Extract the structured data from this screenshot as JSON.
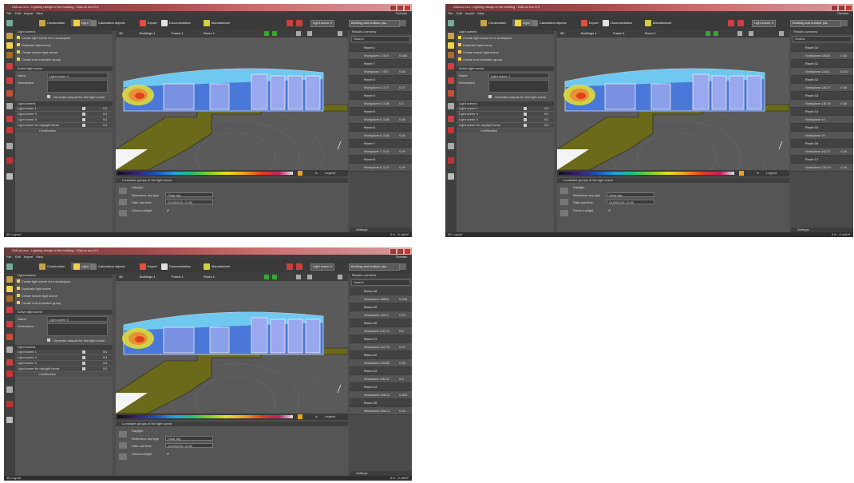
{
  "window": {
    "title": "DIALux evo - Lighting design of the building - DIALux evo 8.0"
  },
  "menu": {
    "items": [
      "File",
      "Edit",
      "Import",
      "View"
    ],
    "help": "Themes"
  },
  "toolbar": {
    "modes": [
      "Construction",
      "Light",
      "Calculation objects",
      "Export",
      "Documentation",
      "Manufacturer"
    ],
    "light_scene_select": "Light scene 4",
    "building_select": "Building and outdoor pla..."
  },
  "left_panel": {
    "light_scenes_header": "Light scenes",
    "actions": [
      "Create light scene for a workspace",
      "Duplicate light scene",
      "Create simple light scene",
      "Create new luminaire group"
    ],
    "active_header": "Active light scene",
    "name_label": "Name",
    "name_value": "Light scene 4",
    "description_label": "Description",
    "generate_label": "Generate outputs for this light scene",
    "light_scenes_list_header": "Light scenes",
    "scenes": [
      "Light scene 1",
      "Light scene 4",
      "Light scene 3",
      "Light scene for daylight factor"
    ],
    "dim_value": "0/1",
    "certification": "Certification"
  },
  "viewport_toolbar": {
    "view_label": "3D",
    "storey": "Buildings 1",
    "frame": "Frame 1",
    "room": "Room 1"
  },
  "daylight": {
    "header": "Luminaire groups of the light scene",
    "title": "Daylight",
    "sky_label": "Reference sky type",
    "sky_value": "Clear sky",
    "date_label": "Date and time",
    "date_value": "01/09/2021 12:00",
    "direct_label": "Direct sunlight"
  },
  "colorbar": {
    "unit": "lx",
    "label": "Legend"
  },
  "screens": [
    {
      "rooms": [
        {
          "room": "Room 1",
          "wp": "Workplane 1",
          "v1": "516",
          "v2": "0.456"
        },
        {
          "room": "Room 7",
          "wp": "Workplane 7",
          "v1": "457",
          "v2": "0.46"
        },
        {
          "room": "Room 3",
          "wp": "Workplane 3",
          "v1": "3.77",
          "v2": "0.37"
        },
        {
          "room": "Room 4",
          "wp": "Workplane 4",
          "v1": "3.38",
          "v2": "0.4"
        },
        {
          "room": "Room 5",
          "wp": "Workplane 5",
          "v1": "3.88",
          "v2": "0.34"
        },
        {
          "room": "Room 6",
          "wp": "Workplane 6",
          "v1": "3.88",
          "v2": "0.34"
        },
        {
          "room": "Room 7",
          "wp": "Workplane 7",
          "v1": "5.02",
          "v2": "0.29"
        },
        {
          "room": "Room 8",
          "wp": "Workplane 8",
          "v1": "5.22",
          "v2": "0.29"
        }
      ]
    },
    {
      "rooms": [
        {
          "room": "Room 10",
          "wp": "Workplane 10",
          "v1": "436",
          "v2": "0.45"
        },
        {
          "room": "Room 11",
          "wp": "Workplane 11",
          "v1": "441",
          "v2": "0.427"
        },
        {
          "room": "Room 12",
          "wp": "Workplane 12",
          "v1": "4.27",
          "v2": "0.38"
        },
        {
          "room": "Room 13",
          "wp": "Workplane 13",
          "v1": "3.76",
          "v2": "0.38"
        },
        {
          "room": "Room 14",
          "wp": "Workplane 14",
          "v1": "",
          "v2": ""
        },
        {
          "room": "Room 15",
          "wp": "Workplane 15",
          "v1": "",
          "v2": ""
        },
        {
          "room": "Room 16",
          "wp": "Workplane 16",
          "v1": "2.57",
          "v2": "0.28"
        },
        {
          "room": "Room 17",
          "wp": "Workplane 17",
          "v1": "3.09",
          "v2": "0.28"
        }
      ]
    },
    {
      "rooms": [
        {
          "room": "Room 18",
          "wp": "Workplane 18",
          "v1": "408",
          "v2": "0.448"
        },
        {
          "room": "Room 19",
          "wp": "Workplane 19",
          "v1": "170",
          "v2": "0.19"
        },
        {
          "room": "Room 20",
          "wp": "Workplane 20",
          "v1": "4.72",
          "v2": "0.4"
        },
        {
          "room": "Room 21",
          "wp": "Workplane 21",
          "v1": "4.78",
          "v2": "0.37"
        },
        {
          "room": "Room 22",
          "wp": "Workplane 22",
          "v1": "3.88",
          "v2": "0.35"
        },
        {
          "room": "Room 23",
          "wp": "Workplane 23",
          "v1": "5.02",
          "v2": "0.3"
        },
        {
          "room": "Room 24",
          "wp": "Workplane 24",
          "v1": "15.6",
          "v2": "0.603"
        },
        {
          "room": "Room 25",
          "wp": "Workplane 25",
          "v1": "13.3",
          "v2": "0.34"
        }
      ]
    }
  ],
  "right_panel": {
    "header": "Results overview",
    "search": "Search",
    "settings": "Settings"
  },
  "status": {
    "left": "3D Layout",
    "right": "0 lx - 0 cd/m²"
  },
  "colors": {
    "floor": "#6b6a1a",
    "heat_blue": "#3a6ad0",
    "bg": "#4d4d4d"
  }
}
